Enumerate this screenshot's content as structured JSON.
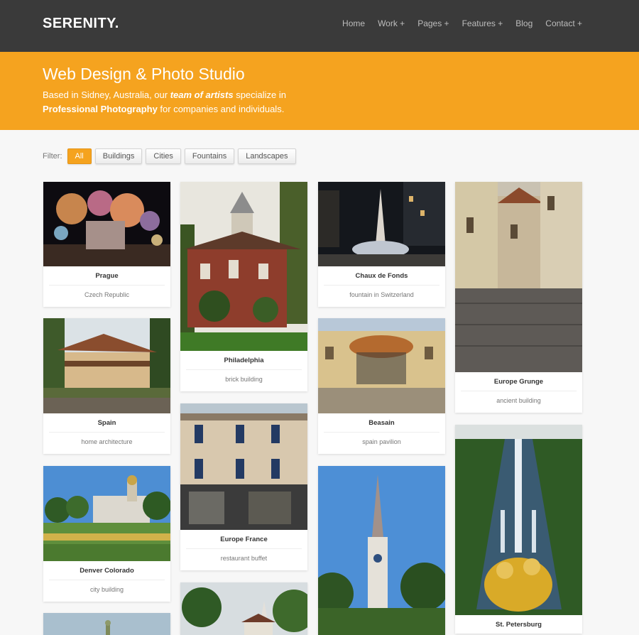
{
  "header": {
    "logo": "SERENITY.",
    "nav": [
      "Home",
      "Work +",
      "Pages +",
      "Features +",
      "Blog",
      "Contact +"
    ]
  },
  "hero": {
    "title": "Web Design & Photo Studio",
    "line1_a": "Based in Sidney, Australia, our ",
    "line1_em": "team of artists",
    "line1_b": " specialize in",
    "line2_strong": "Professional Photography",
    "line2_b": " for companies and individuals."
  },
  "filter": {
    "label": "Filter:",
    "buttons": [
      "All",
      "Buildings",
      "Cities",
      "Fountains",
      "Landscapes"
    ],
    "active": "All"
  },
  "cards": [
    {
      "title": "Prague",
      "subtitle": "Czech Republic"
    },
    {
      "title": "Philadelphia",
      "subtitle": "brick building"
    },
    {
      "title": "Chaux de Fonds",
      "subtitle": "fountain in Switzerland"
    },
    {
      "title": "Europe Grunge",
      "subtitle": "ancient building"
    },
    {
      "title": "Spain",
      "subtitle": "home architecture"
    },
    {
      "title": "Beasain",
      "subtitle": "spain pavilion"
    },
    {
      "title": "Europe France",
      "subtitle": "restaurant buffet"
    },
    {
      "title": "Denver Colorado",
      "subtitle": "city building"
    },
    {
      "title": "St. Petersburg",
      "subtitle": ""
    }
  ]
}
